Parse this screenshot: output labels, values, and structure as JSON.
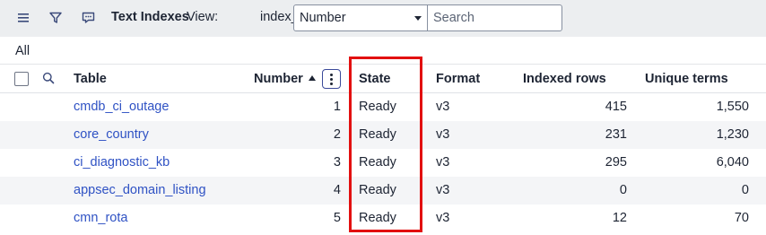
{
  "toolbar": {
    "title": "Text Indexes",
    "view_label": "View:",
    "view_value": "index_name",
    "select_value": "Number",
    "search_placeholder": "Search"
  },
  "icons": {
    "menu": "hamburger-menu-icon",
    "filter": "filter-funnel-icon",
    "message": "chat-message-icon",
    "search": "search-icon",
    "column_options": "vertical-dots-icon"
  },
  "breadcrumb": {
    "label": "All"
  },
  "columns": {
    "table": "Table",
    "number": "Number",
    "state": "State",
    "format": "Format",
    "indexed_rows": "Indexed rows",
    "unique_terms": "Unique terms"
  },
  "rows": [
    {
      "table": "cmdb_ci_outage",
      "number": "1",
      "state": "Ready",
      "format": "v3",
      "indexed_rows": "415",
      "unique_terms": "1,550"
    },
    {
      "table": "core_country",
      "number": "2",
      "state": "Ready",
      "format": "v3",
      "indexed_rows": "231",
      "unique_terms": "1,230"
    },
    {
      "table": "ci_diagnostic_kb",
      "number": "3",
      "state": "Ready",
      "format": "v3",
      "indexed_rows": "295",
      "unique_terms": "6,040"
    },
    {
      "table": "appsec_domain_listing",
      "number": "4",
      "state": "Ready",
      "format": "v3",
      "indexed_rows": "0",
      "unique_terms": "0"
    },
    {
      "table": "cmn_rota",
      "number": "5",
      "state": "Ready",
      "format": "v3",
      "indexed_rows": "12",
      "unique_terms": "70"
    }
  ],
  "colors": {
    "link": "#2f52c4",
    "highlight": "#e21010",
    "toolbar_bg": "#eceef0",
    "alt_row": "#f4f5f7"
  }
}
